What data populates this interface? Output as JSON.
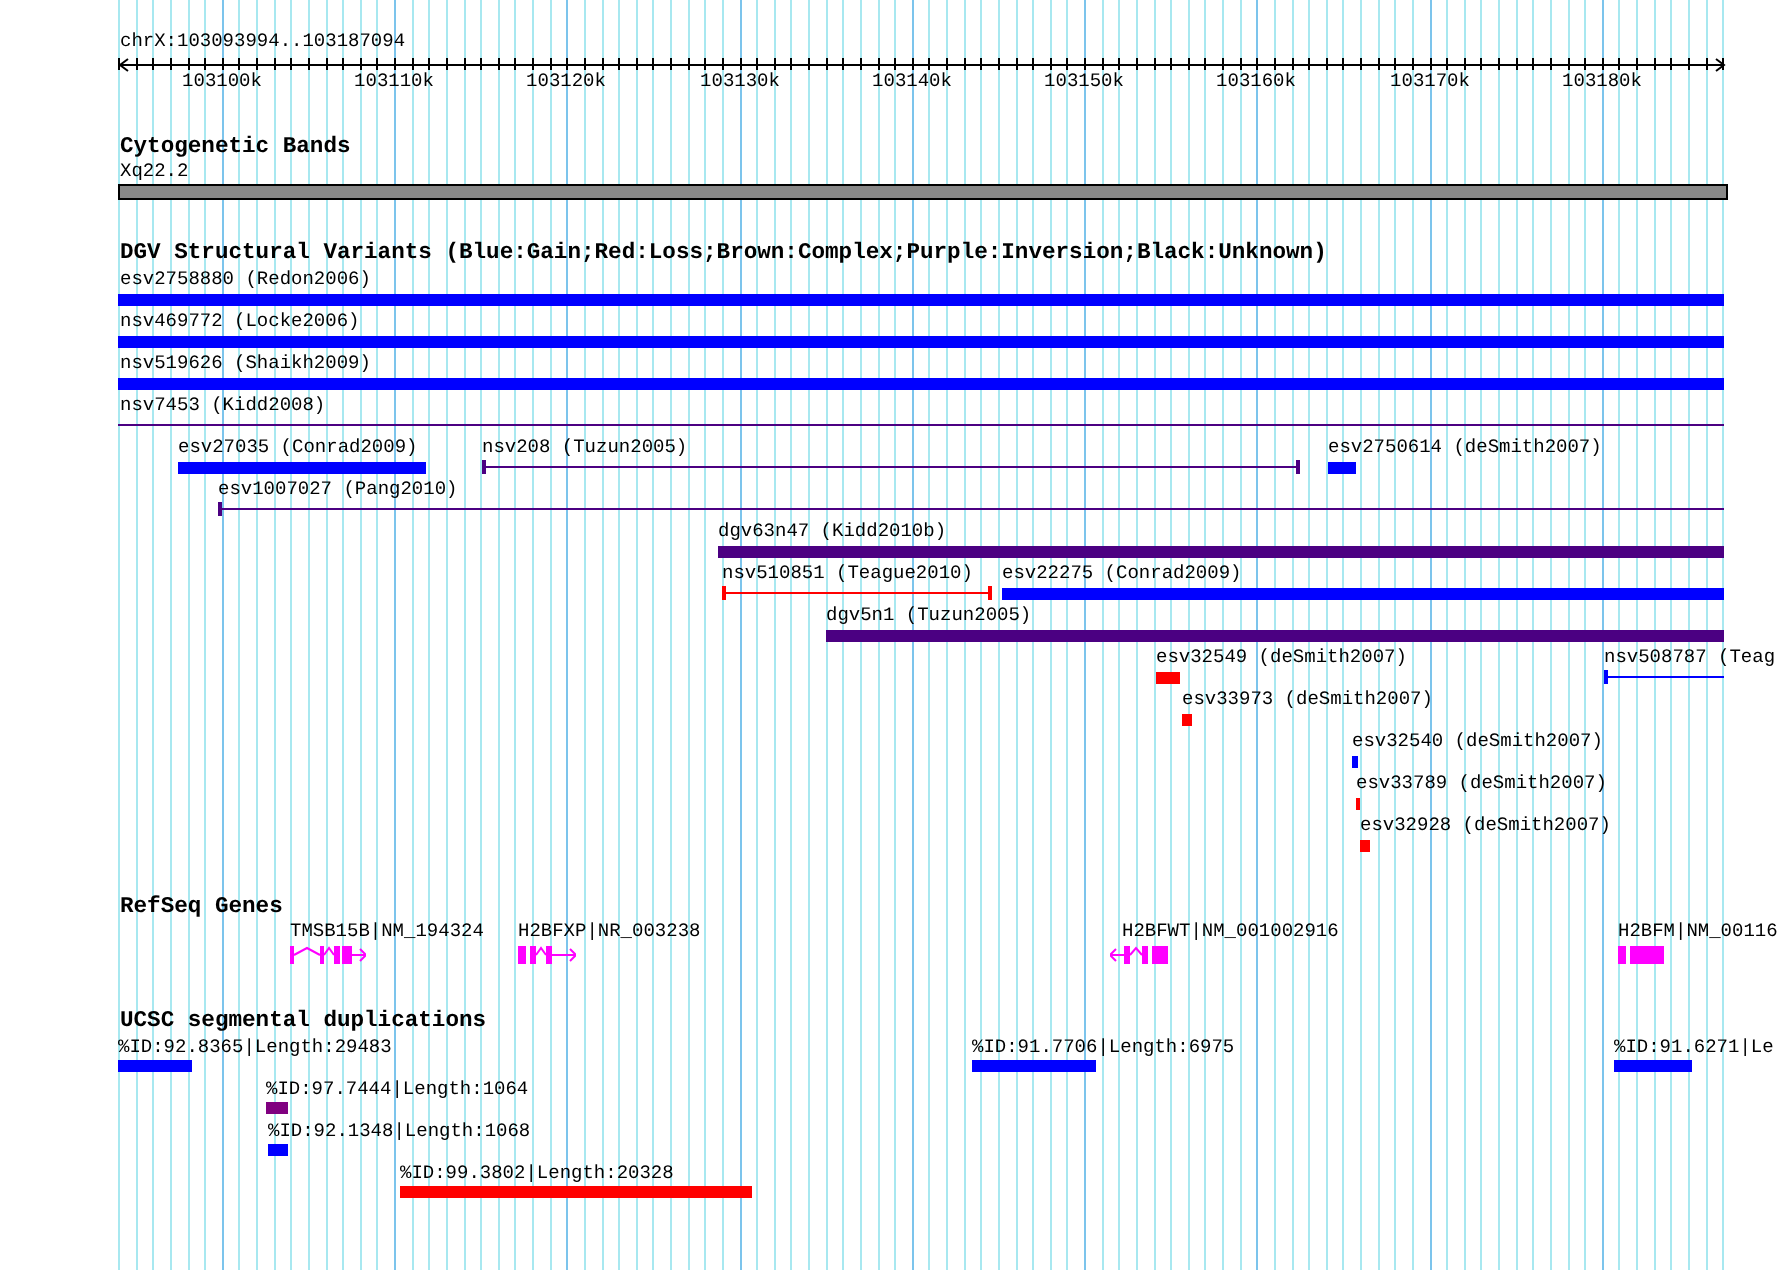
{
  "ruler": {
    "position": "chrX:103093994..103187094",
    "ticks": [
      "103100k",
      "103110k",
      "103120k",
      "103130k",
      "103140k",
      "103150k",
      "103160k",
      "103170k",
      "103180k"
    ]
  },
  "cytobands": {
    "title": "Cytogenetic Bands",
    "band": "Xq22.2"
  },
  "dgv": {
    "title": "DGV Structural Variants (Blue:Gain;Red:Loss;Brown:Complex;Purple:Inversion;Black:Unknown)",
    "variants": [
      {
        "label": "esv2758880 (Redon2006)",
        "kind": "bar",
        "color": "#0000ff"
      },
      {
        "label": "nsv469772 (Locke2006)",
        "kind": "bar",
        "color": "#0000ff"
      },
      {
        "label": "nsv519626 (Shaikh2009)",
        "kind": "bar",
        "color": "#0000ff"
      },
      {
        "label": "nsv7453 (Kidd2008)",
        "kind": "line",
        "color": "#4b0082"
      },
      {
        "label": "esv27035 (Conrad2009)",
        "kind": "bar",
        "color": "#0000ff"
      },
      {
        "label": "nsv208 (Tuzun2005)",
        "kind": "line",
        "color": "#4b0082"
      },
      {
        "label": "esv2750614 (deSmith2007)",
        "kind": "bar",
        "color": "#0000ff"
      },
      {
        "label": "esv1007027 (Pang2010)",
        "kind": "line",
        "color": "#4b0082"
      },
      {
        "label": "dgv63n47 (Kidd2010b)",
        "kind": "bar",
        "color": "#4b0082"
      },
      {
        "label": "nsv510851 (Teague2010)",
        "kind": "line",
        "color": "#ff0000"
      },
      {
        "label": "esv22275 (Conrad2009)",
        "kind": "bar",
        "color": "#0000ff"
      },
      {
        "label": "dgv5n1 (Tuzun2005)",
        "kind": "bar",
        "color": "#4b0082"
      },
      {
        "label": "esv32549 (deSmith2007)",
        "kind": "bar",
        "color": "#ff0000"
      },
      {
        "label": "nsv508787 (Teag",
        "kind": "line",
        "color": "#0000ff"
      },
      {
        "label": "esv33973 (deSmith2007)",
        "kind": "bar",
        "color": "#ff0000"
      },
      {
        "label": "esv32540 (deSmith2007)",
        "kind": "bar",
        "color": "#0000ff"
      },
      {
        "label": "esv33789 (deSmith2007)",
        "kind": "bar",
        "color": "#ff0000"
      },
      {
        "label": "esv32928 (deSmith2007)",
        "kind": "bar",
        "color": "#ff0000"
      }
    ]
  },
  "refseq": {
    "title": "RefSeq Genes",
    "genes": [
      {
        "label": "TMSB15B|NM_194324",
        "reverse_strand": false
      },
      {
        "label": "H2BFXP|NR_003238",
        "reverse_strand": false
      },
      {
        "label": "H2BFWT|NM_001002916",
        "reverse_strand": true
      },
      {
        "label": "H2BFM|NM_00116"
      }
    ]
  },
  "segdups": {
    "title": "UCSC segmental duplications",
    "items": [
      {
        "label": "%ID:92.8365|Length:29483",
        "color": "#0000ff"
      },
      {
        "label": "%ID:97.7444|Length:1064",
        "color": "#800080"
      },
      {
        "label": "%ID:92.1348|Length:1068",
        "color": "#0000ff"
      },
      {
        "label": "%ID:99.3802|Length:20328",
        "color": "#ff0000"
      },
      {
        "label": "%ID:91.7706|Length:6975",
        "color": "#0000ff"
      },
      {
        "label": "%ID:91.6271|Le",
        "color": "#0000ff"
      }
    ]
  }
}
